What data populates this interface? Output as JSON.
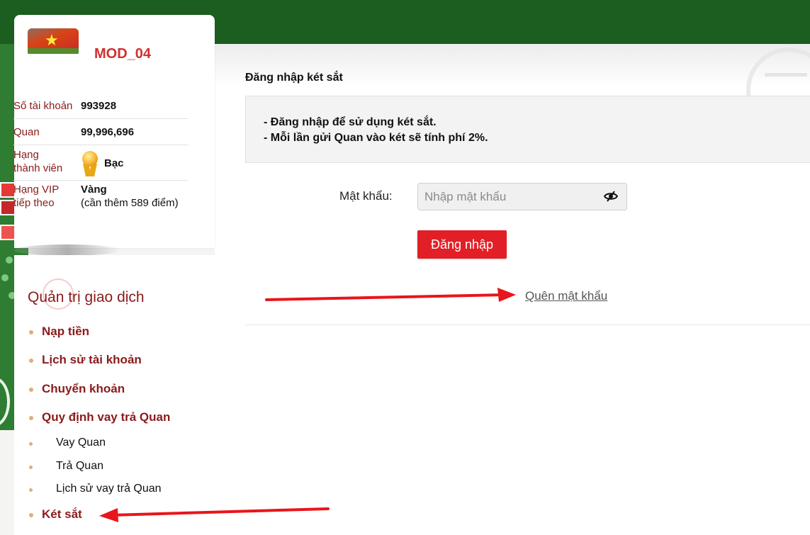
{
  "profile": {
    "username": "MOD_04",
    "account_number_label": "Số tài khoản",
    "account_number": "993928",
    "balance_label": "Quan",
    "balance": "99,996,696",
    "rank_label_line1": "Hạng",
    "rank_label_line2": "thành viên",
    "rank_value": "Bạc",
    "vip_label_line1": "Hạng VIP",
    "vip_label_line2": "tiếp theo",
    "vip_value": "Vàng",
    "vip_note": "(cần thêm 589 điểm)"
  },
  "menu": {
    "title": "Quản trị giao dịch",
    "items": [
      {
        "label": "Nạp tiền"
      },
      {
        "label": "Lịch sử tài khoản"
      },
      {
        "label": "Chuyển khoản"
      },
      {
        "label": "Quy định vay trả Quan"
      }
    ],
    "sub_items": [
      {
        "label": "Vay Quan"
      },
      {
        "label": "Trả Quan"
      },
      {
        "label": "Lịch sử vay trả Quan"
      }
    ],
    "safe_label": "Két sắt"
  },
  "main": {
    "section_title": "Đăng nhập két sắt",
    "notice_line1": "- Đăng nhập để sử dụng két sắt.",
    "notice_line2": "- Mỗi lần gửi Quan vào két sẽ tính phí 2%.",
    "password_label": "Mật khẩu:",
    "password_placeholder": "Nhập mật khẩu",
    "login_button": "Đăng nhập",
    "forgot_link": "Quên mật khẩu"
  },
  "colors": {
    "header_green": "#1b5e20",
    "accent_red": "#e21f26",
    "menu_text": "#8b1a1a",
    "annotation_arrow": "#e8151b"
  },
  "icons": {
    "avatar": "vietnam-flag-avatar",
    "rank": "medal-icon",
    "password_toggle": "eye-slash-icon"
  }
}
